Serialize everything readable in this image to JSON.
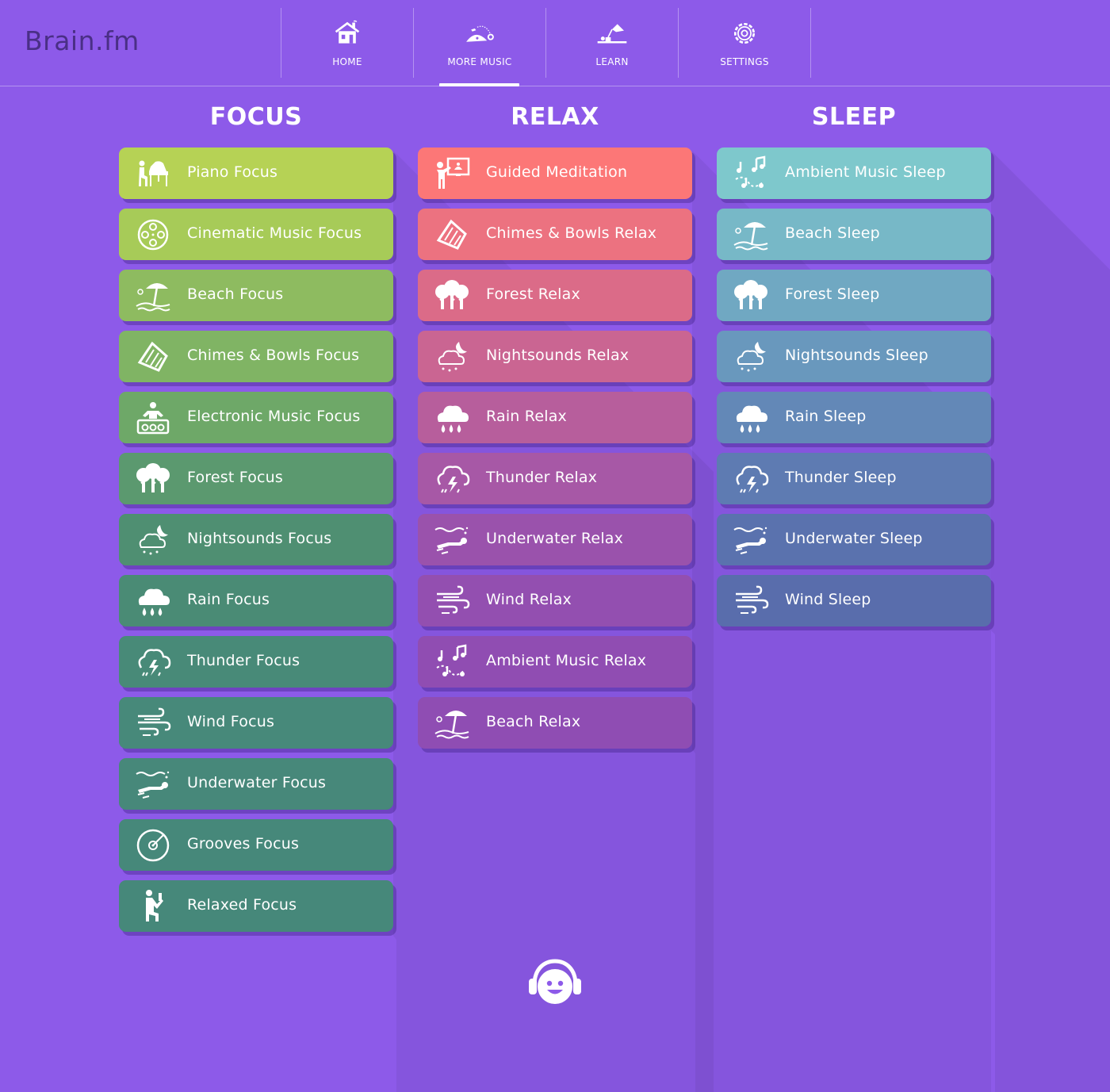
{
  "app": {
    "logo": "Brain.fm"
  },
  "nav": [
    {
      "label": "HOME",
      "icon": "home-icon",
      "active": false
    },
    {
      "label": "MORE MUSIC",
      "icon": "more-music-icon",
      "active": true
    },
    {
      "label": "LEARN",
      "icon": "learn-icon",
      "active": false
    },
    {
      "label": "SETTINGS",
      "icon": "gear-icon",
      "active": false
    }
  ],
  "columns": [
    {
      "title": "FOCUS",
      "items": [
        {
          "label": "Piano Focus",
          "icon": "piano-icon",
          "color": "#b6d255"
        },
        {
          "label": "Cinematic Music Focus",
          "icon": "film-reel-icon",
          "color": "#a7cb58"
        },
        {
          "label": "Beach Focus",
          "icon": "beach-icon",
          "color": "#8ebb60"
        },
        {
          "label": "Chimes & Bowls Focus",
          "icon": "chimes-icon",
          "color": "#80b464"
        },
        {
          "label": "Electronic Music Focus",
          "icon": "dj-icon",
          "color": "#6ea868"
        },
        {
          "label": "Forest Focus",
          "icon": "forest-icon",
          "color": "#5b996f"
        },
        {
          "label": "Nightsounds Focus",
          "icon": "nightsounds-icon",
          "color": "#4f8f72"
        },
        {
          "label": "Rain Focus",
          "icon": "rain-icon",
          "color": "#4a8b75"
        },
        {
          "label": "Thunder Focus",
          "icon": "thunder-icon",
          "color": "#488a78"
        },
        {
          "label": "Wind Focus",
          "icon": "wind-icon",
          "color": "#47897a"
        },
        {
          "label": "Underwater Focus",
          "icon": "diver-icon",
          "color": "#47887a"
        },
        {
          "label": "Grooves Focus",
          "icon": "vinyl-icon",
          "color": "#46887a"
        },
        {
          "label": "Relaxed Focus",
          "icon": "relaxed-person-icon",
          "color": "#46887a"
        }
      ]
    },
    {
      "title": "RELAX",
      "items": [
        {
          "label": "Guided Meditation",
          "icon": "presenter-icon",
          "color": "#fc7777"
        },
        {
          "label": "Chimes & Bowls Relax",
          "icon": "chimes-icon",
          "color": "#ec7280"
        },
        {
          "label": "Forest Relax",
          "icon": "forest-icon",
          "color": "#db6b88"
        },
        {
          "label": "Nightsounds Relax",
          "icon": "nightsounds-icon",
          "color": "#ca6592"
        },
        {
          "label": "Rain Relax",
          "icon": "rain-icon",
          "color": "#b75e9c"
        },
        {
          "label": "Thunder Relax",
          "icon": "thunder-icon",
          "color": "#a758a6"
        },
        {
          "label": "Underwater Relax",
          "icon": "diver-icon",
          "color": "#9a52ac"
        },
        {
          "label": "Wind Relax",
          "icon": "wind-icon",
          "color": "#934fb0"
        },
        {
          "label": "Ambient Music Relax",
          "icon": "music-notes-icon",
          "color": "#904db2"
        },
        {
          "label": "Beach Relax",
          "icon": "beach-icon",
          "color": "#8f4db3"
        }
      ]
    },
    {
      "title": "SLEEP",
      "items": [
        {
          "label": "Ambient Music Sleep",
          "icon": "music-notes-icon",
          "color": "#7ec8cc"
        },
        {
          "label": "Beach Sleep",
          "icon": "beach-icon",
          "color": "#77b8c7"
        },
        {
          "label": "Forest Sleep",
          "icon": "forest-icon",
          "color": "#70a8c2"
        },
        {
          "label": "Nightsounds Sleep",
          "icon": "nightsounds-icon",
          "color": "#6998bd"
        },
        {
          "label": "Rain Sleep",
          "icon": "rain-icon",
          "color": "#6388b7"
        },
        {
          "label": "Thunder Sleep",
          "icon": "thunder-icon",
          "color": "#5e7bb2"
        },
        {
          "label": "Underwater Sleep",
          "icon": "diver-icon",
          "color": "#5a72ae"
        },
        {
          "label": "Wind Sleep",
          "icon": "wind-icon",
          "color": "#596dac"
        }
      ]
    }
  ],
  "footer": {
    "icon": "headphones-mascot-icon"
  }
}
